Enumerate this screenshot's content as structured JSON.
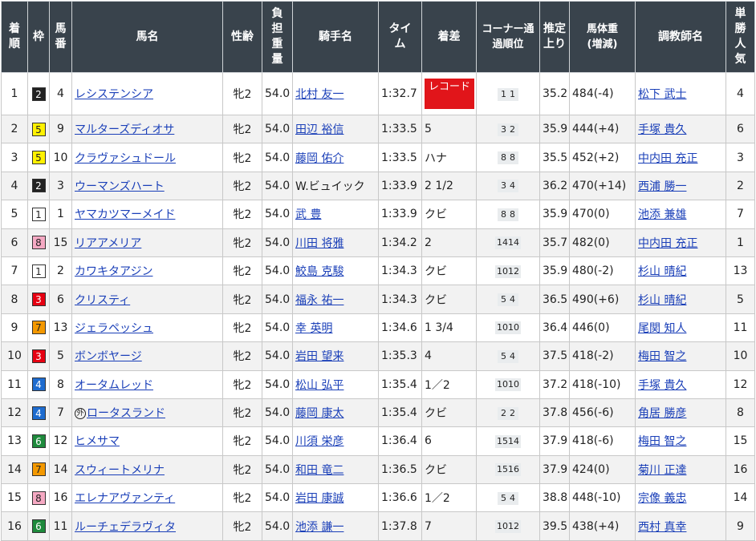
{
  "headers": {
    "rank": "着順",
    "waku": "枠",
    "umaban": "馬番",
    "horse": "馬名",
    "sexage": "性齢",
    "weight": "負担重量",
    "jockey": "騎手名",
    "time": "タイム",
    "margin": "着差",
    "corner": "コーナー通過順位",
    "last": "推定上り",
    "body": "馬体重(増減)",
    "trainer": "調教師名",
    "pop": "単勝人気"
  },
  "waku_colors": {
    "1": {
      "bg": "#ffffff",
      "fg": "#222222"
    },
    "2": {
      "bg": "#222222",
      "fg": "#ffffff"
    },
    "3": {
      "bg": "#e60012",
      "fg": "#ffffff"
    },
    "4": {
      "bg": "#1e6ccf",
      "fg": "#ffffff"
    },
    "5": {
      "bg": "#fff100",
      "fg": "#222222"
    },
    "6": {
      "bg": "#1e8a3c",
      "fg": "#ffffff"
    },
    "7": {
      "bg": "#f39800",
      "fg": "#222222"
    },
    "8": {
      "bg": "#f5a9c3",
      "fg": "#222222"
    }
  },
  "rows": [
    {
      "rank": "1",
      "waku": "2",
      "umaban": "4",
      "horse": "レシステンシア",
      "foreign": false,
      "sexage": "牝2",
      "weight": "54.0",
      "jockey": "北村 友一",
      "time": "1:32.7",
      "margin": "",
      "record": "レコード",
      "corner": [
        "1",
        "1"
      ],
      "last": "35.2",
      "body": "484(-4)",
      "trainer": "松下 武士",
      "pop": "4"
    },
    {
      "rank": "2",
      "waku": "5",
      "umaban": "9",
      "horse": "マルターズディオサ",
      "foreign": false,
      "sexage": "牝2",
      "weight": "54.0",
      "jockey": "田辺 裕信",
      "time": "1:33.5",
      "margin": "5",
      "record": "",
      "corner": [
        "3",
        "2"
      ],
      "last": "35.9",
      "body": "444(+4)",
      "trainer": "手塚 貴久",
      "pop": "6"
    },
    {
      "rank": "3",
      "waku": "5",
      "umaban": "10",
      "horse": "クラヴァシュドール",
      "foreign": false,
      "sexage": "牝2",
      "weight": "54.0",
      "jockey": "藤岡 佑介",
      "time": "1:33.5",
      "margin": "ハナ",
      "record": "",
      "corner": [
        "8",
        "8"
      ],
      "last": "35.5",
      "body": "452(+2)",
      "trainer": "中内田 充正",
      "pop": "3"
    },
    {
      "rank": "4",
      "waku": "2",
      "umaban": "3",
      "horse": "ウーマンズハート",
      "foreign": false,
      "sexage": "牝2",
      "weight": "54.0",
      "jockey": "W.ビュイック",
      "time": "1:33.9",
      "margin": "2 1/2",
      "record": "",
      "corner": [
        "3",
        "4"
      ],
      "last": "36.2",
      "body": "470(+14)",
      "trainer": "西浦 勝一",
      "pop": "2"
    },
    {
      "rank": "5",
      "waku": "1",
      "umaban": "1",
      "horse": "ヤマカツマーメイド",
      "foreign": false,
      "sexage": "牝2",
      "weight": "54.0",
      "jockey": "武 豊",
      "time": "1:33.9",
      "margin": "クビ",
      "record": "",
      "corner": [
        "8",
        "8"
      ],
      "last": "35.9",
      "body": "470(0)",
      "trainer": "池添 兼雄",
      "pop": "7"
    },
    {
      "rank": "6",
      "waku": "8",
      "umaban": "15",
      "horse": "リアアメリア",
      "foreign": false,
      "sexage": "牝2",
      "weight": "54.0",
      "jockey": "川田 将雅",
      "time": "1:34.2",
      "margin": "2",
      "record": "",
      "corner": [
        "14",
        "14"
      ],
      "last": "35.7",
      "body": "482(0)",
      "trainer": "中内田 充正",
      "pop": "1"
    },
    {
      "rank": "7",
      "waku": "1",
      "umaban": "2",
      "horse": "カワキタアジン",
      "foreign": false,
      "sexage": "牝2",
      "weight": "54.0",
      "jockey": "鮫島 克駿",
      "time": "1:34.3",
      "margin": "クビ",
      "record": "",
      "corner": [
        "10",
        "12"
      ],
      "last": "35.9",
      "body": "480(-2)",
      "trainer": "杉山 晴紀",
      "pop": "13"
    },
    {
      "rank": "8",
      "waku": "3",
      "umaban": "6",
      "horse": "クリスティ",
      "foreign": false,
      "sexage": "牝2",
      "weight": "54.0",
      "jockey": "福永 祐一",
      "time": "1:34.3",
      "margin": "クビ",
      "record": "",
      "corner": [
        "5",
        "4"
      ],
      "last": "36.5",
      "body": "490(+6)",
      "trainer": "杉山 晴紀",
      "pop": "5"
    },
    {
      "rank": "9",
      "waku": "7",
      "umaban": "13",
      "horse": "ジェラペッシュ",
      "foreign": false,
      "sexage": "牝2",
      "weight": "54.0",
      "jockey": "幸 英明",
      "time": "1:34.6",
      "margin": "1 3/4",
      "record": "",
      "corner": [
        "10",
        "10"
      ],
      "last": "36.4",
      "body": "446(0)",
      "trainer": "尾関 知人",
      "pop": "11"
    },
    {
      "rank": "10",
      "waku": "3",
      "umaban": "5",
      "horse": "ボンボヤージ",
      "foreign": false,
      "sexage": "牝2",
      "weight": "54.0",
      "jockey": "岩田 望来",
      "time": "1:35.3",
      "margin": "4",
      "record": "",
      "corner": [
        "5",
        "4"
      ],
      "last": "37.5",
      "body": "418(-2)",
      "trainer": "梅田 智之",
      "pop": "10"
    },
    {
      "rank": "11",
      "waku": "4",
      "umaban": "8",
      "horse": "オータムレッド",
      "foreign": false,
      "sexage": "牝2",
      "weight": "54.0",
      "jockey": "松山 弘平",
      "time": "1:35.4",
      "margin": "1／2",
      "record": "",
      "corner": [
        "10",
        "10"
      ],
      "last": "37.2",
      "body": "418(-10)",
      "trainer": "手塚 貴久",
      "pop": "12"
    },
    {
      "rank": "12",
      "waku": "4",
      "umaban": "7",
      "horse": "ロータスランド",
      "foreign": true,
      "foreign_mark": "外",
      "sexage": "牝2",
      "weight": "54.0",
      "jockey": "藤岡 康太",
      "time": "1:35.4",
      "margin": "クビ",
      "record": "",
      "corner": [
        "2",
        "2"
      ],
      "last": "37.8",
      "body": "456(-6)",
      "trainer": "角居 勝彦",
      "pop": "8"
    },
    {
      "rank": "13",
      "waku": "6",
      "umaban": "12",
      "horse": "ヒメサマ",
      "foreign": false,
      "sexage": "牝2",
      "weight": "54.0",
      "jockey": "川須 栄彦",
      "time": "1:36.4",
      "margin": "6",
      "record": "",
      "corner": [
        "15",
        "14"
      ],
      "last": "37.9",
      "body": "418(-6)",
      "trainer": "梅田 智之",
      "pop": "15"
    },
    {
      "rank": "14",
      "waku": "7",
      "umaban": "14",
      "horse": "スウィートメリナ",
      "foreign": false,
      "sexage": "牝2",
      "weight": "54.0",
      "jockey": "和田 竜二",
      "time": "1:36.5",
      "margin": "クビ",
      "record": "",
      "corner": [
        "15",
        "16"
      ],
      "last": "37.9",
      "body": "424(0)",
      "trainer": "菊川 正達",
      "pop": "16"
    },
    {
      "rank": "15",
      "waku": "8",
      "umaban": "16",
      "horse": "エレナアヴァンティ",
      "foreign": false,
      "sexage": "牝2",
      "weight": "54.0",
      "jockey": "岩田 康誠",
      "time": "1:36.6",
      "margin": "1／2",
      "record": "",
      "corner": [
        "5",
        "4"
      ],
      "last": "38.8",
      "body": "448(-10)",
      "trainer": "宗像 義忠",
      "pop": "14"
    },
    {
      "rank": "16",
      "waku": "6",
      "umaban": "11",
      "horse": "ルーチェデラヴィタ",
      "foreign": false,
      "sexage": "牝2",
      "weight": "54.0",
      "jockey": "池添 謙一",
      "time": "1:37.8",
      "margin": "7",
      "record": "",
      "corner": [
        "10",
        "12"
      ],
      "last": "39.5",
      "body": "438(+4)",
      "trainer": "西村 真幸",
      "pop": "9"
    }
  ]
}
